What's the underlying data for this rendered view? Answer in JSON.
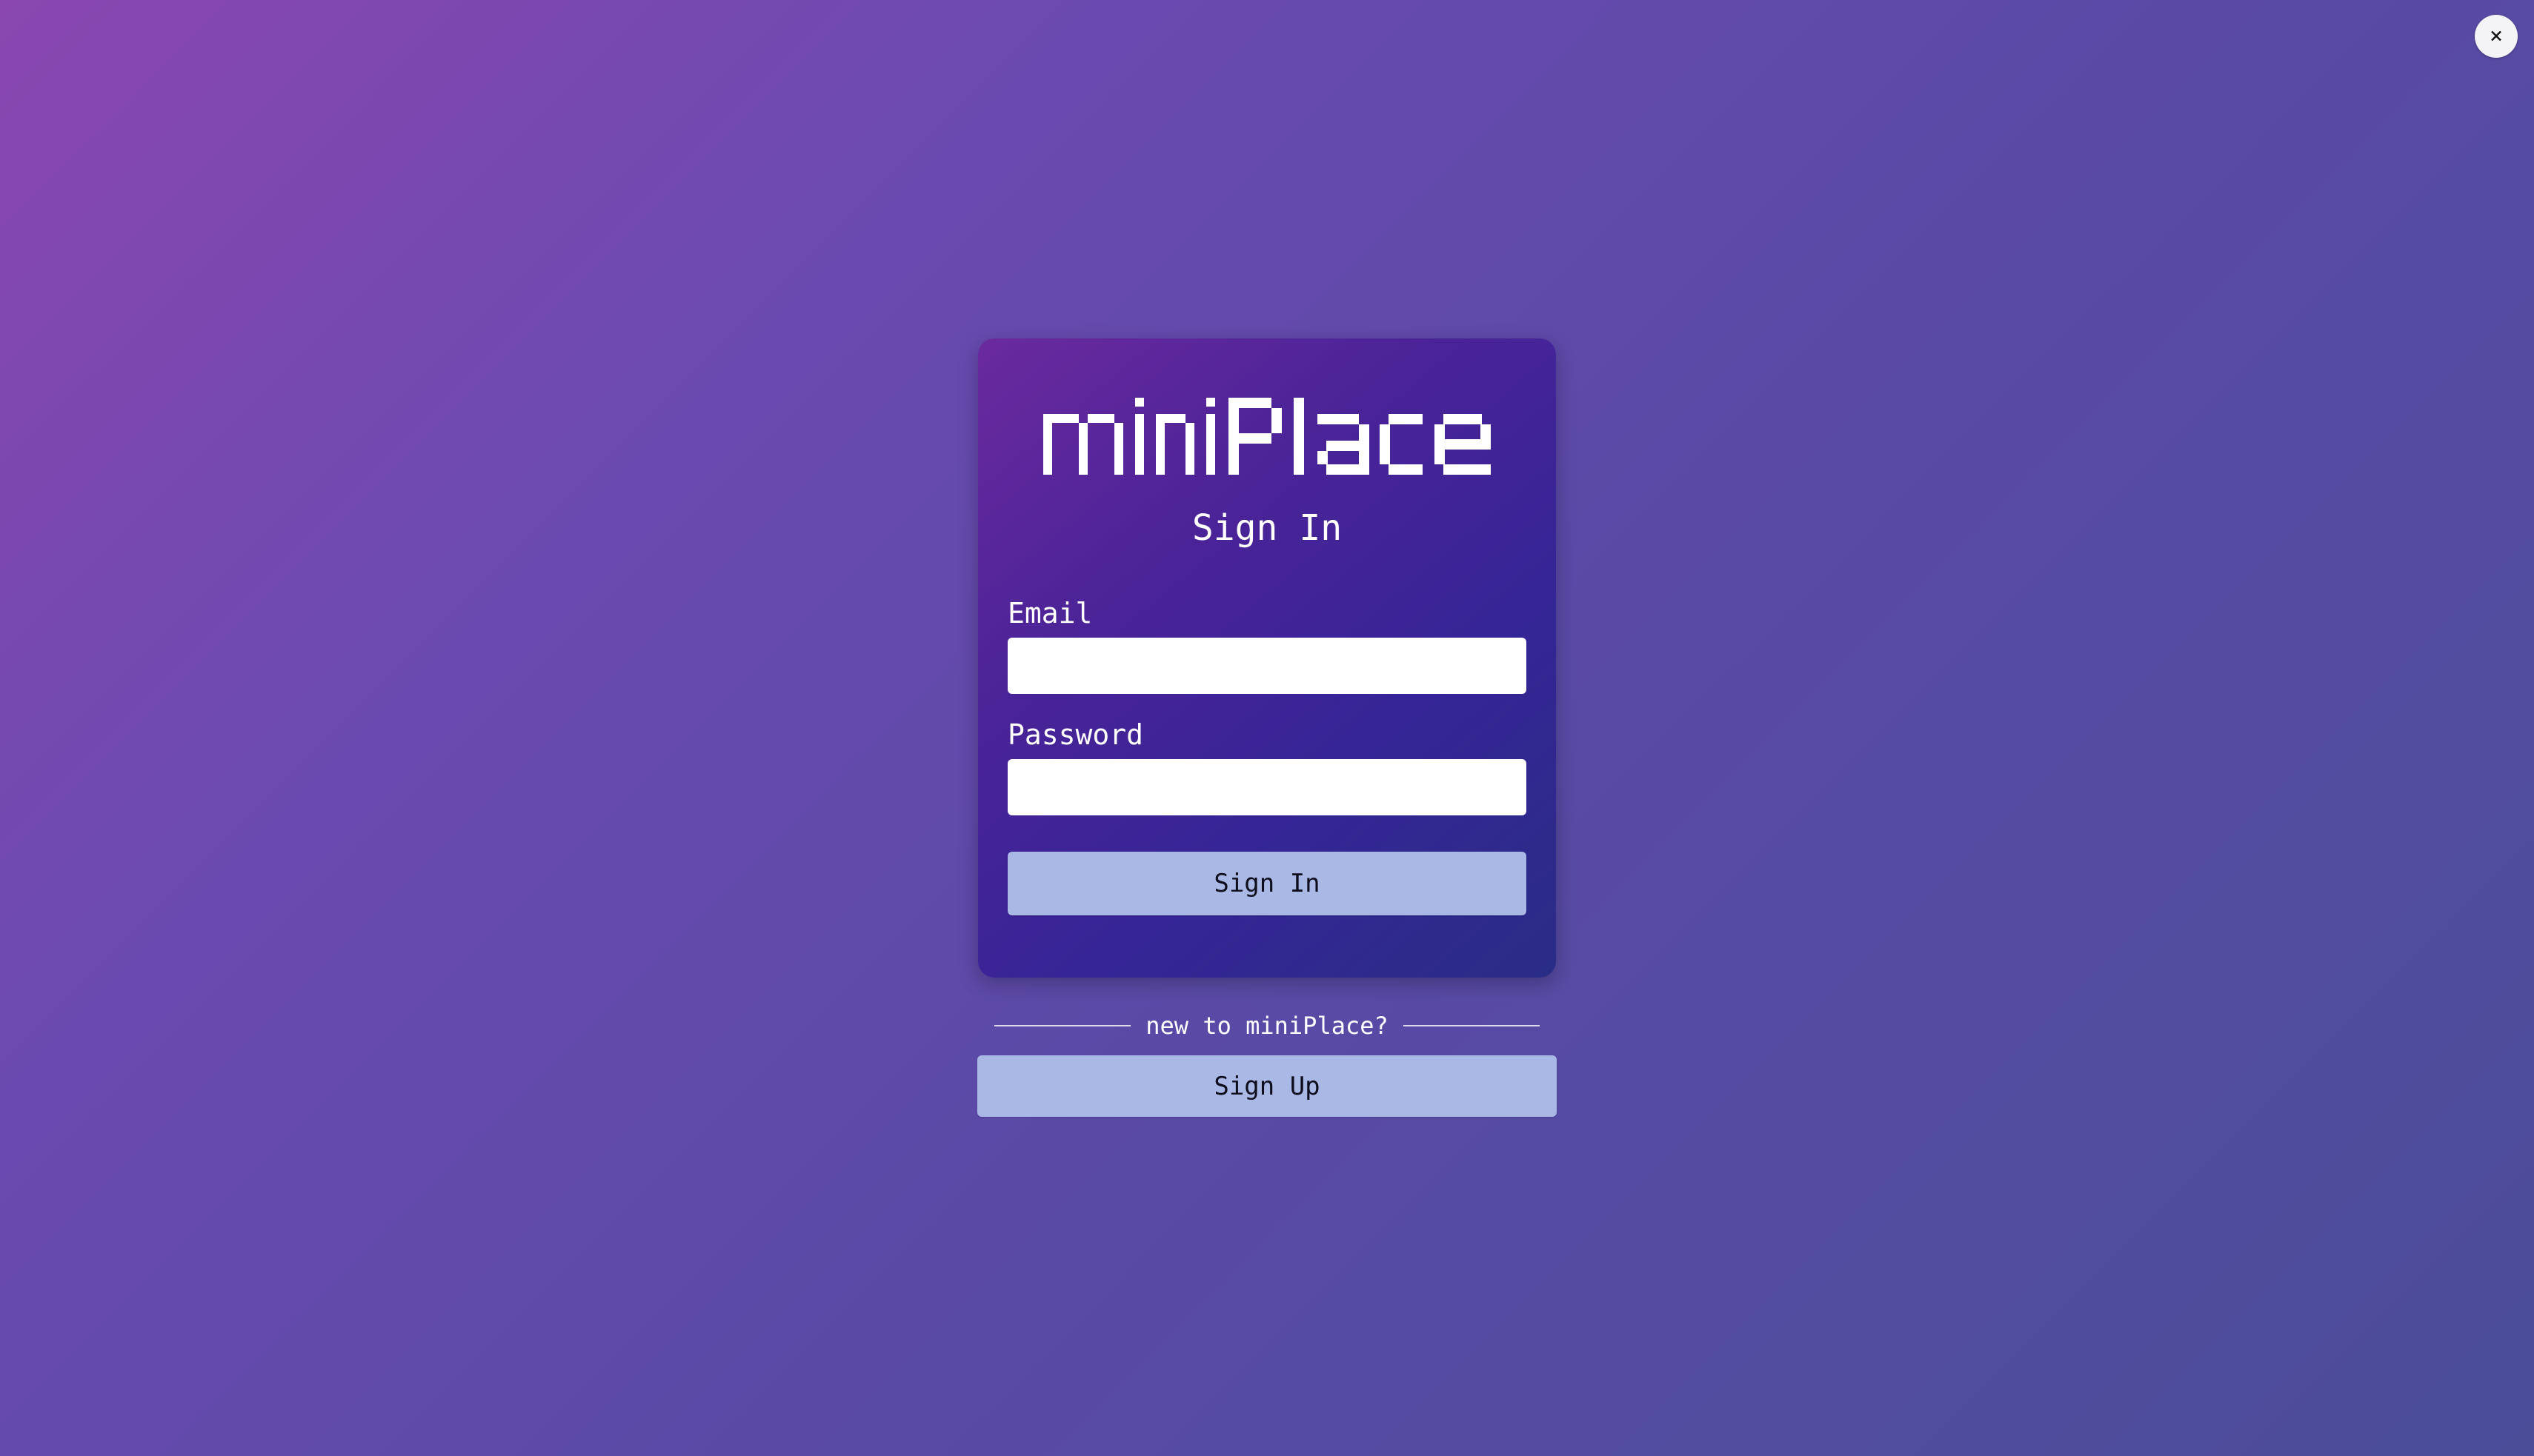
{
  "close_button": {
    "label": "×"
  },
  "logo": {
    "text": "miniPlace"
  },
  "signin_card": {
    "title": "Sign In",
    "email": {
      "label": "Email",
      "value": "",
      "placeholder": ""
    },
    "password": {
      "label": "Password",
      "value": "",
      "placeholder": ""
    },
    "submit_label": "Sign In"
  },
  "signup": {
    "prompt": "new to miniPlace?",
    "button_label": "Sign Up"
  },
  "colors": {
    "button_bg": "#aab8e6",
    "card_bg_start": "#6a2a9e",
    "card_bg_end": "#2a2d86",
    "page_bg_start": "#8a47b0",
    "page_bg_end": "#4b4d99"
  }
}
